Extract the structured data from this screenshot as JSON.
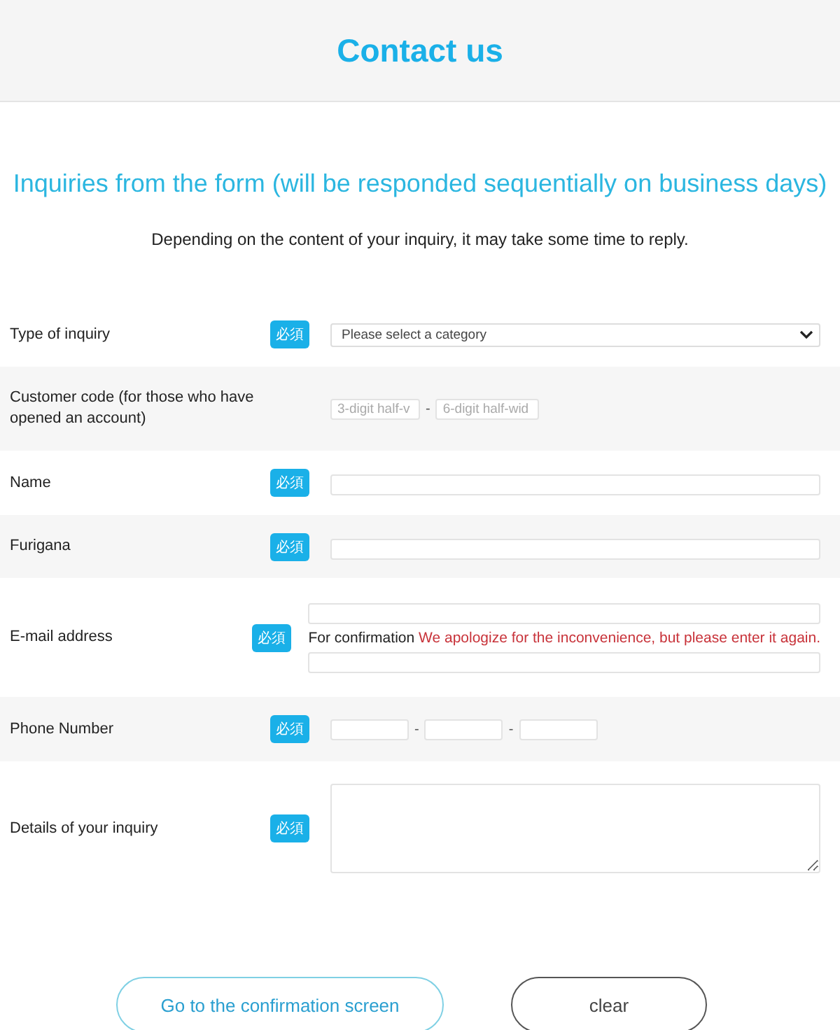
{
  "header": {
    "title": "Contact us"
  },
  "heading": "Inquiries from the form (will be responded sequentially on business days)",
  "intro": "Depending on the content of your inquiry, it may take some time to reply.",
  "rows": [
    {
      "kind": "select",
      "label": "Type of inquiry",
      "badge": "必須",
      "placeholder": "Please select a category"
    },
    {
      "kind": "code",
      "label": "Customer code (for those who have opened an account)",
      "placeholders": [
        "3-digit half-v",
        "6-digit half-wid"
      ],
      "separator": "-"
    },
    {
      "kind": "text",
      "label": "Name",
      "badge": "必須"
    },
    {
      "kind": "text",
      "label": "Furigana",
      "badge": "必須"
    },
    {
      "kind": "email",
      "label": "E-mail address",
      "badge": "必須",
      "note": "For confirmation",
      "warning": "We apologize for the inconvenience, but please enter it again."
    },
    {
      "kind": "phone",
      "label": "Phone Number",
      "badge": "必須",
      "separators": [
        "-",
        "-"
      ]
    },
    {
      "kind": "textarea",
      "label": "Details of your inquiry",
      "badge": "必須"
    }
  ],
  "buttons": [
    {
      "kind": "primary",
      "label": "Go to the confirmation screen"
    },
    {
      "kind": "secondary",
      "label": "clear"
    }
  ]
}
